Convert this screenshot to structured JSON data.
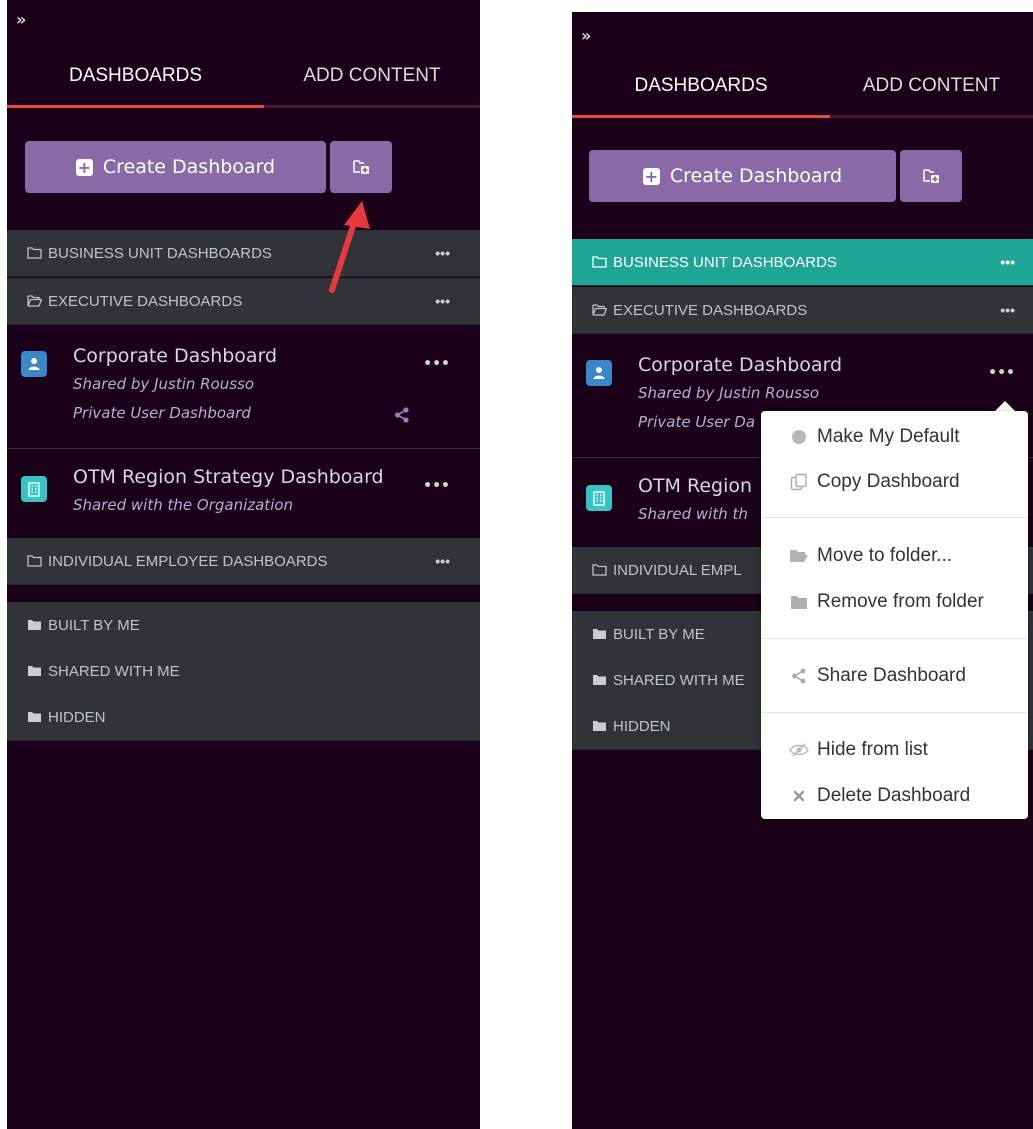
{
  "left_panel": {
    "tabs": [
      {
        "label": "DASHBOARDS"
      },
      {
        "label": "ADD CONTENT"
      }
    ],
    "create_button": "Create Dashboard",
    "folders": [
      {
        "label": "BUSINESS UNIT DASHBOARDS",
        "icon": "folder-outline-icon"
      },
      {
        "label": "EXECUTIVE DASHBOARDS",
        "icon": "folder-open-outline-icon"
      }
    ],
    "dashboards": [
      {
        "title": "Corporate Dashboard",
        "subtitle": "Shared by Justin Rousso",
        "subtitle2": "Private User Dashboard",
        "icon": "user-icon"
      },
      {
        "title": "OTM Region Strategy Dashboard",
        "subtitle": "Shared with the Organization",
        "icon": "building-icon"
      }
    ],
    "individual_folder": "INDIVIDUAL EMPLOYEE DASHBOARDS",
    "system_folders": [
      {
        "label": "BUILT BY ME"
      },
      {
        "label": "SHARED WITH ME"
      },
      {
        "label": "HIDDEN"
      }
    ]
  },
  "right_panel": {
    "tabs": [
      {
        "label": "DASHBOARDS"
      },
      {
        "label": "ADD CONTENT"
      }
    ],
    "create_button": "Create Dashboard",
    "folders": [
      {
        "label": "BUSINESS UNIT DASHBOARDS",
        "highlighted": true
      },
      {
        "label": "EXECUTIVE DASHBOARDS"
      }
    ],
    "dashboards": [
      {
        "title": "Corporate Dashboard",
        "subtitle": "Shared by Justin Rousso",
        "subtitle2": "Private User Da"
      },
      {
        "title": "OTM Region",
        "subtitle": "Shared with th"
      }
    ],
    "individual_folder": "INDIVIDUAL EMPL",
    "system_folders": [
      {
        "label": "BUILT BY ME"
      },
      {
        "label": "SHARED WITH ME"
      },
      {
        "label": "HIDDEN"
      }
    ]
  },
  "context_menu": {
    "items": [
      {
        "label": "Make My Default",
        "icon": "circle-icon"
      },
      {
        "label": "Copy Dashboard",
        "icon": "copy-icon"
      },
      {
        "label": "Move to folder...",
        "icon": "folder-open-icon"
      },
      {
        "label": "Remove from folder",
        "icon": "folder-icon"
      },
      {
        "label": "Share Dashboard",
        "icon": "share-icon"
      },
      {
        "label": "Hide from list",
        "icon": "eye-slash-icon"
      },
      {
        "label": "Delete Dashboard",
        "icon": "close-icon"
      }
    ]
  },
  "colors": {
    "panel_bg": "#1a0018",
    "accent_button": "#8a6aa6",
    "tab_active_underline": "#e4494b",
    "folder_row_bg": "#303438",
    "highlight_folder": "#1fa596",
    "annotation_arrow": "#e8383d"
  }
}
